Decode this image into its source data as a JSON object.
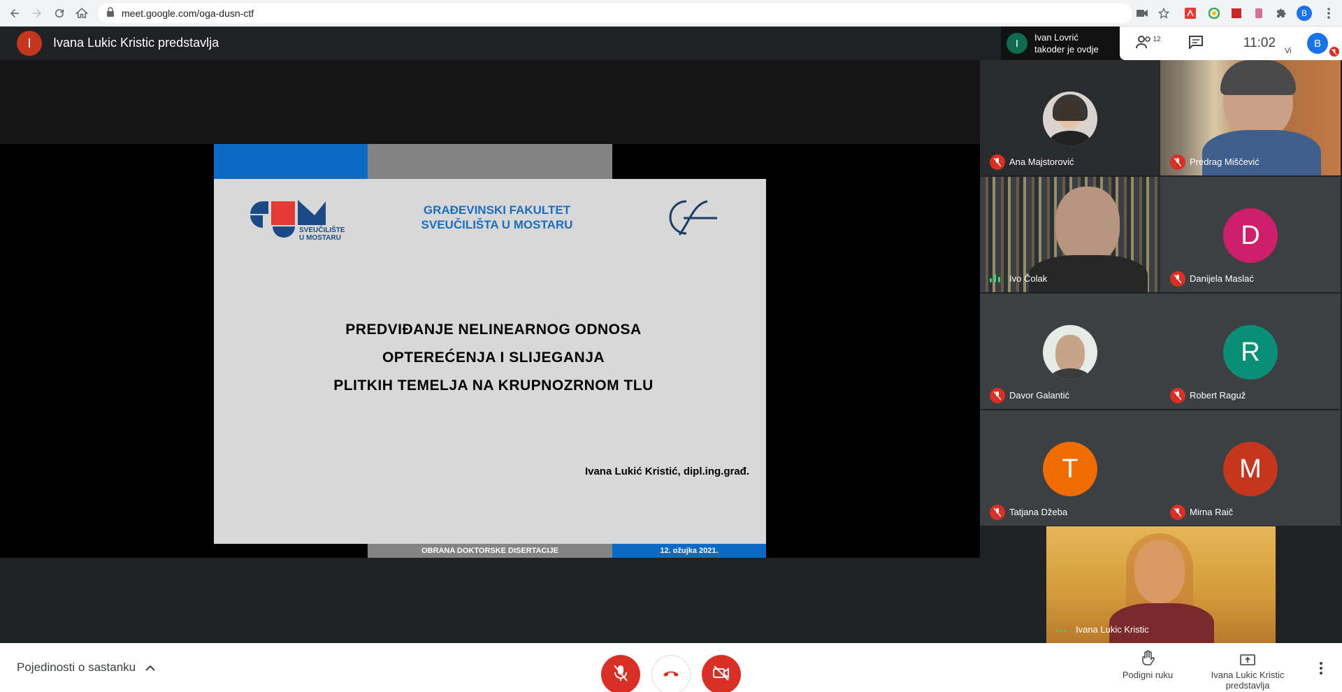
{
  "browser": {
    "url": "meet.google.com/oga-dusn-ctf"
  },
  "topbar": {
    "presenter_initial": "I",
    "presenter_title": "Ivana Lukic Kristic predstavlja",
    "notice_initial": "I",
    "notice_name": "Ivan Lovrić",
    "notice_text": "takoder je ovdje",
    "participants_count": "12",
    "time": "11:02",
    "self_initial": "B",
    "self_label": "Vi"
  },
  "slide": {
    "logo_text_1": "SVEUČILIŠTE",
    "logo_text_2": "U MOSTARU",
    "faculty_line_1": "GRAĐEVINSKI FAKULTET",
    "faculty_line_2": "SVEUČILIŠTA U MOSTARU",
    "title_line_1": "PREDVIĐANJE NELINEARNOG ODNOSA",
    "title_line_2": "OPTEREĆENJA I SLIJEGANJA",
    "title_line_3": "PLITKIH TEMELJA NA KRUPNOZRNOM TLU",
    "author": "Ivana Lukić Kristić, dipl.ing.građ.",
    "footer_left": "OBRANA DOKTORSKE DISERTACIJE",
    "footer_right": "12. ožujka 2021."
  },
  "participants": [
    {
      "name": "Ana Majstorović",
      "kind": "photo",
      "muted": true
    },
    {
      "name": "Predrag Miščević",
      "kind": "photo",
      "muted": true
    },
    {
      "name": "Ivo Čolak",
      "kind": "photo",
      "muted": false,
      "speaking": true
    },
    {
      "name": "Danijela Maslać",
      "kind": "initial",
      "initial": "D",
      "color": "#d01f6a",
      "muted": true
    },
    {
      "name": "Davor Galantić",
      "kind": "photo",
      "muted": true
    },
    {
      "name": "Robert Raguž",
      "kind": "initial",
      "initial": "R",
      "color": "#0b8f76",
      "muted": true
    },
    {
      "name": "Tatjana Džeba",
      "kind": "initial",
      "initial": "T",
      "color": "#ef6c00",
      "muted": true
    },
    {
      "name": "Mirna Raič",
      "kind": "initial",
      "initial": "M",
      "color": "#c5361e",
      "muted": true
    }
  ],
  "presenter_tile": {
    "name": "Ivana Lukic Kristic"
  },
  "bottombar": {
    "details_label": "Pojedinosti o sastanku",
    "raise_hand_label": "Podigni ruku",
    "present_label_1": "Ivana Lukic Kristic",
    "present_label_2": "predstavlja"
  },
  "colors": {
    "accent_red": "#d93025",
    "slide_blue": "#0b6ac4",
    "slide_gray": "#848484"
  }
}
